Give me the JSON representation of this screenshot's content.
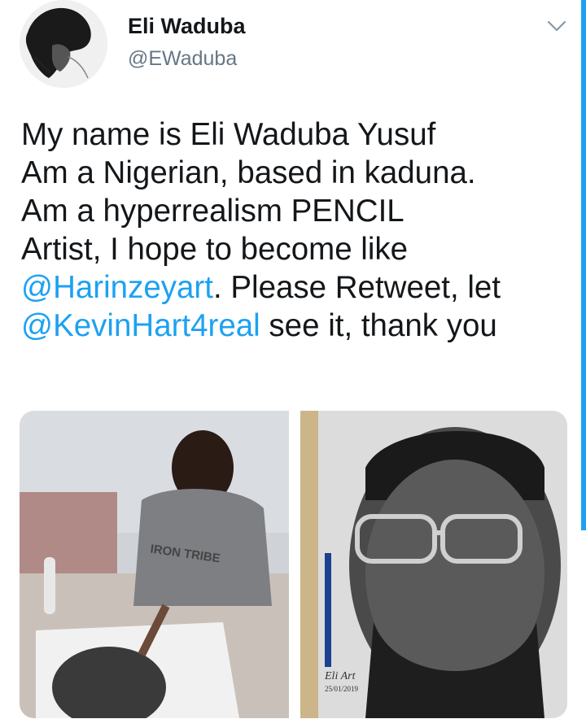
{
  "author": {
    "display_name": "Eli Waduba",
    "handle": "@EWaduba"
  },
  "tweet": {
    "line1": "My name is Eli Waduba Yusuf",
    "line2": "Am a Nigerian, based in kaduna.",
    "line3": "Am a hyperrealism PENCIL",
    "line4": "Artist, I hope to become like",
    "mention1": "@Harinzeyart",
    "line5_rest": ". Please Retweet, let",
    "mention2": "@KevinHart4real",
    "line6_rest": " see it, thank you"
  },
  "media": {
    "left_shirt_text": "IRON TRIBE",
    "right_signature": "Eli Art",
    "right_date": "25/01/2019"
  },
  "icons": {
    "more_options": "chevron-down-icon"
  },
  "colors": {
    "accent": "#1da1f2",
    "text": "#14171a",
    "muted": "#657786"
  }
}
